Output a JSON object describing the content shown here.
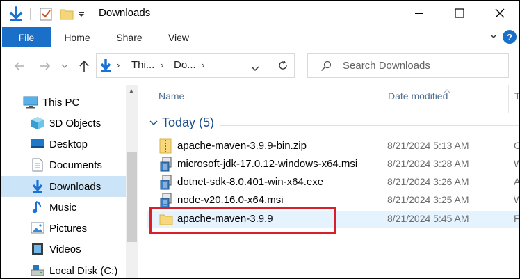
{
  "window": {
    "title": "Downloads"
  },
  "ribbon": {
    "tabs": [
      "File",
      "Home",
      "Share",
      "View"
    ],
    "help_label": "?"
  },
  "address": {
    "crumbs": [
      "Thi...",
      "Do..."
    ],
    "search_placeholder": "Search Downloads"
  },
  "navpane": {
    "items": [
      {
        "label": "This PC",
        "icon": "this-pc-icon"
      },
      {
        "label": "3D Objects",
        "icon": "3d-objects-icon"
      },
      {
        "label": "Desktop",
        "icon": "desktop-icon"
      },
      {
        "label": "Documents",
        "icon": "documents-icon"
      },
      {
        "label": "Downloads",
        "icon": "downloads-icon",
        "selected": true
      },
      {
        "label": "Music",
        "icon": "music-icon"
      },
      {
        "label": "Pictures",
        "icon": "pictures-icon"
      },
      {
        "label": "Videos",
        "icon": "videos-icon"
      },
      {
        "label": "Local Disk (C:)",
        "icon": "local-disk-icon"
      }
    ]
  },
  "content": {
    "columns": [
      "Name",
      "Date modified",
      "T"
    ],
    "group_label": "Today (5)",
    "files": [
      {
        "name": "apache-maven-3.9.9-bin.zip",
        "date": "8/21/2024 5:13 AM",
        "type": "C",
        "icon": "zip-folder-icon"
      },
      {
        "name": "microsoft-jdk-17.0.12-windows-x64.msi",
        "date": "8/21/2024 3:28 AM",
        "type": "W",
        "icon": "msi-installer-icon"
      },
      {
        "name": "dotnet-sdk-8.0.401-win-x64.exe",
        "date": "8/21/2024 3:26 AM",
        "type": "A",
        "icon": "exe-installer-icon"
      },
      {
        "name": "node-v20.16.0-x64.msi",
        "date": "8/21/2024 3:25 AM",
        "type": "W",
        "icon": "msi-installer-icon"
      },
      {
        "name": "apache-maven-3.9.9",
        "date": "8/21/2024 5:45 AM",
        "type": "F",
        "icon": "folder-icon",
        "selected": true
      }
    ]
  },
  "colors": {
    "accent": "#1a6fc8",
    "selection": "#cce4f7",
    "highlight_box": "#d9202a"
  }
}
